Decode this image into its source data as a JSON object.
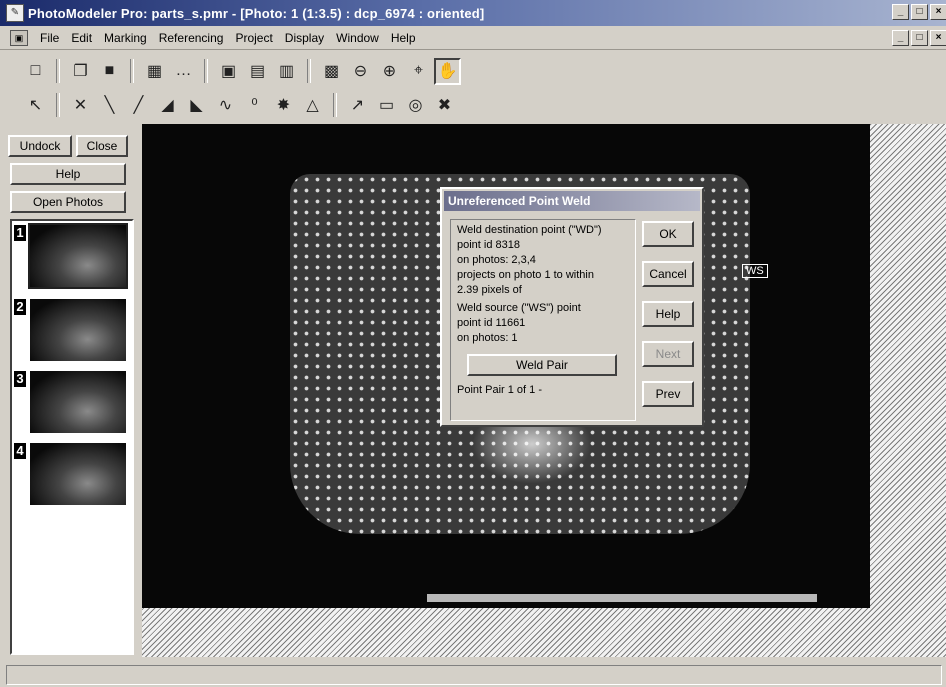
{
  "window": {
    "title": "PhotoModeler Pro: parts_s.pmr - [Photo: 1 (1:3.5) : dcp_6974 : oriented]",
    "controls_outer": [
      "_",
      "□",
      "×"
    ],
    "controls_inner": [
      "_",
      "□",
      "×"
    ]
  },
  "menubar": {
    "items": [
      "File",
      "Edit",
      "Marking",
      "Referencing",
      "Project",
      "Display",
      "Window",
      "Help"
    ]
  },
  "toolbar1": {
    "icons": [
      "new-icon",
      "open-icon",
      "save-icon",
      "table-icon",
      "marker-icon",
      "photo-icon",
      "grid-icon",
      "grid-dark-icon",
      "3d-viewer-icon",
      "zoom-out-icon",
      "zoom-in-icon",
      "zoom-fit-icon",
      "hand-icon"
    ],
    "glyphs": [
      "□",
      "❐",
      "■",
      "▦",
      "…",
      "▣",
      "▤",
      "▥",
      "▩",
      "⊖",
      "⊕",
      "⌖",
      "✋"
    ]
  },
  "toolbar2": {
    "icons": [
      "select-arrow-icon",
      "mark-point-icon",
      "line-icon",
      "edge-icon",
      "surface-icon",
      "surface-alt-icon",
      "curve-icon",
      "cylinder-icon",
      "target-icon",
      "triangle-icon",
      "reference-icon",
      "measure-icon",
      "globe-icon",
      "delete-icon"
    ],
    "glyphs": [
      "↖",
      "✕",
      "╲",
      "╱",
      "◢",
      "◣",
      "∿",
      "⁰",
      "✸",
      "△",
      "↗",
      "▭",
      "◎",
      "✖"
    ]
  },
  "leftpanel": {
    "undock": "Undock",
    "close": "Close",
    "help": "Help",
    "open_photos": "Open Photos",
    "thumbs": [
      "1",
      "2",
      "3",
      "4"
    ]
  },
  "photo": {
    "ws_label": "WS"
  },
  "dialog": {
    "title": "Unreferenced Point Weld",
    "lines": [
      "Weld destination point (\"WD\")",
      "point id  8318",
      "on photos:  2,3,4",
      "projects on photo 1     to within",
      "2.39   pixels of",
      "Weld source (\"WS\") point",
      "point id  11661",
      "on photos:  1"
    ],
    "weld_pair": "Weld Pair",
    "point_pair": "Point Pair  1      of 1 -",
    "ok": "OK",
    "cancel": "Cancel",
    "help": "Help",
    "next": "Next",
    "prev": "Prev"
  },
  "statusbar": {
    "text": ""
  }
}
